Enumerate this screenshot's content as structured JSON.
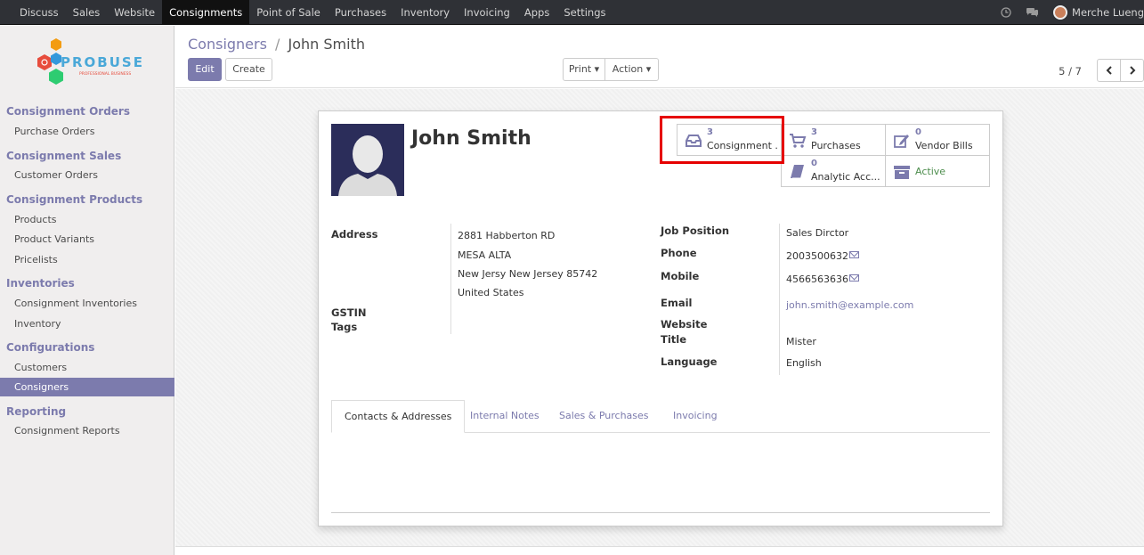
{
  "topbar": {
    "menu": [
      "Discuss",
      "Sales",
      "Website",
      "Consignments",
      "Point of Sale",
      "Purchases",
      "Inventory",
      "Invoicing",
      "Apps",
      "Settings"
    ],
    "active": "Consignments",
    "username": "Merche Lueng"
  },
  "logo": {
    "brand": "PROBUSE",
    "tagline": "PROFESSIONAL BUSINESS"
  },
  "sidebar": {
    "sections": [
      {
        "title": "Consignment Orders",
        "items": [
          "Purchase Orders"
        ]
      },
      {
        "title": "Consignment Sales",
        "items": [
          "Customer Orders"
        ]
      },
      {
        "title": "Consignment Products",
        "items": [
          "Products",
          "Product Variants",
          "Pricelists"
        ]
      },
      {
        "title": "Inventories",
        "items": [
          "Consignment Inventories",
          "Inventory"
        ]
      },
      {
        "title": "Configurations",
        "items": [
          "Customers",
          "Consigners"
        ]
      },
      {
        "title": "Reporting",
        "items": [
          "Consignment Reports"
        ]
      }
    ],
    "active_item": "Consigners"
  },
  "control_panel": {
    "breadcrumb_parent": "Consigners",
    "breadcrumb_sep": "/",
    "breadcrumb_current": "John Smith",
    "edit_label": "Edit",
    "create_label": "Create",
    "print_label": "Print ▾",
    "action_label": "Action ▾",
    "pager": "5 / 7"
  },
  "record": {
    "name": "John Smith",
    "smart_buttons": [
      {
        "count": "3",
        "label": "Consignment ...",
        "icon": "inbox-icon"
      },
      {
        "count": "3",
        "label": "Purchases",
        "icon": "cart-icon"
      },
      {
        "count": "0",
        "label": "Vendor Bills",
        "icon": "edit-icon"
      },
      {
        "count": "0",
        "label": "Analytic Acc...",
        "icon": "book-icon"
      },
      {
        "count": "",
        "label": "Active",
        "icon": "archive-icon"
      }
    ],
    "left_fields": {
      "address_label": "Address",
      "address_lines": [
        "2881 Habberton RD",
        "MESA ALTA",
        "New Jersy  New Jersey  85742",
        "United States"
      ],
      "gstin_label": "GSTIN",
      "tags_label": "Tags"
    },
    "right_fields": {
      "job_position_label": "Job Position",
      "job_position": "Sales Dirctor",
      "phone_label": "Phone",
      "phone": "2003500632",
      "mobile_label": "Mobile",
      "mobile": "4566563636",
      "email_label": "Email",
      "email": "john.smith@example.com",
      "website_label": "Website",
      "title_label": "Title",
      "title": "Mister",
      "language_label": "Language",
      "language": "English"
    },
    "tabs": [
      "Contacts & Addresses",
      "Internal Notes",
      "Sales & Purchases",
      "Invoicing"
    ]
  },
  "colors": {
    "accent": "#7c7bad",
    "topbar": "#2f3136",
    "highlight": "#e60000",
    "active_green": "#4b8c4b"
  }
}
